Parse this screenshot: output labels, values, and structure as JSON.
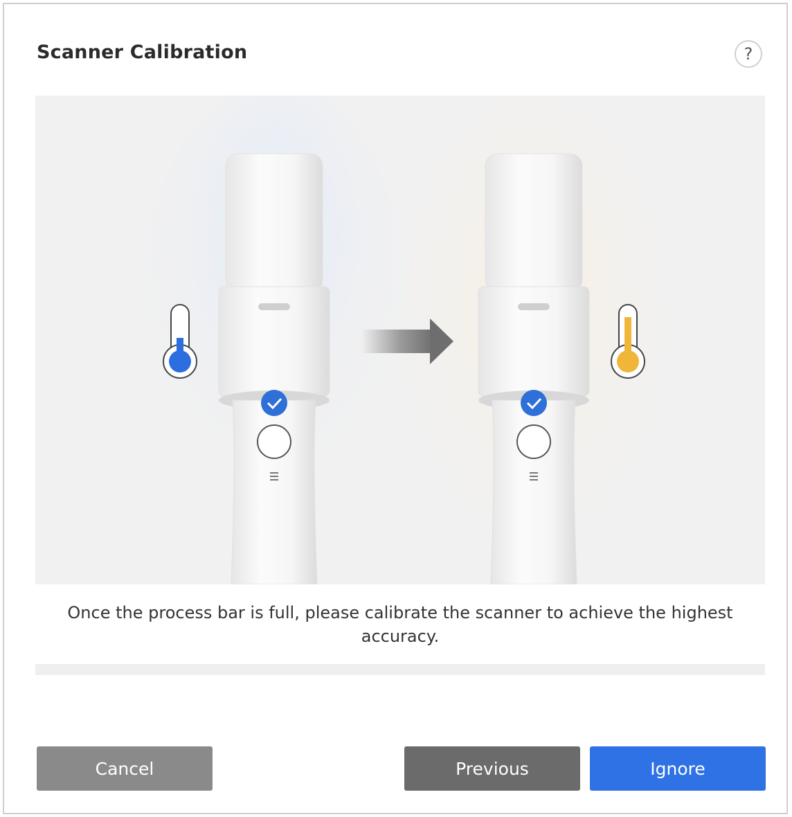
{
  "dialog": {
    "title": "Scanner Calibration",
    "help_icon": "question-mark-icon",
    "help_symbol": "?"
  },
  "illustration": {
    "cold_thermometer_color": "#2c6de0",
    "warm_thermometer_color": "#f0b63a",
    "check_badge_color": "#2f6fd8",
    "arrow_icon": "arrow-right-icon"
  },
  "message": "Once the process bar is full, please calibrate the scanner to achieve the highest accuracy.",
  "progress": {
    "value": 0,
    "fill_color": "#2e6fe0"
  },
  "buttons": {
    "cancel": "Cancel",
    "previous": "Previous",
    "ignore": "Ignore"
  },
  "colors": {
    "primary": "#2f72e6",
    "cancel": "#8a8a8a",
    "previous": "#6b6b6b"
  }
}
